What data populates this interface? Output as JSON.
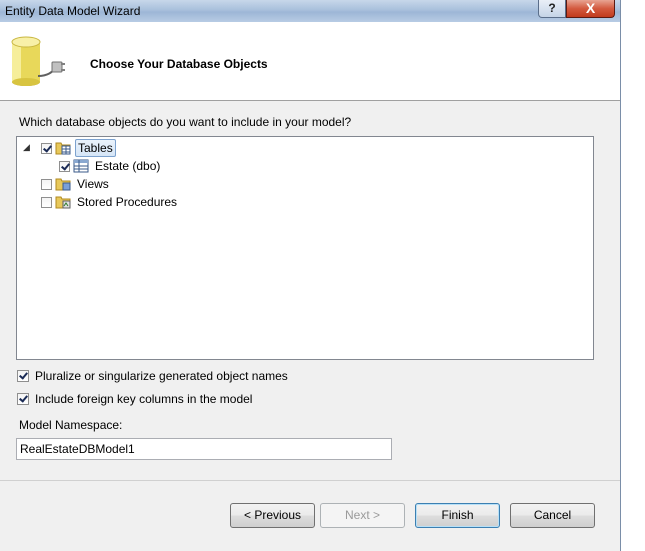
{
  "window": {
    "title": "Entity Data Model Wizard",
    "help_label": "?",
    "close_label": "X"
  },
  "header": {
    "heading": "Choose Your Database Objects",
    "icon": "database-connection-icon"
  },
  "prompt": "Which database objects do you want to include in your model?",
  "tree": {
    "tables": {
      "label": "Tables",
      "checked": true,
      "expanded": true,
      "children": [
        {
          "label": "Estate (dbo)",
          "checked": true
        }
      ]
    },
    "views": {
      "label": "Views",
      "checked": false
    },
    "procedures": {
      "label": "Stored Procedures",
      "checked": false
    }
  },
  "options": {
    "pluralize": {
      "label": "Pluralize or singularize generated object names",
      "checked": true
    },
    "foreign_keys": {
      "label": "Include foreign key columns in the model",
      "checked": true
    }
  },
  "namespace": {
    "label": "Model Namespace:",
    "value": "RealEstateDBModel1"
  },
  "buttons": {
    "previous": "< Previous",
    "next": "Next >",
    "finish": "Finish",
    "cancel": "Cancel"
  }
}
